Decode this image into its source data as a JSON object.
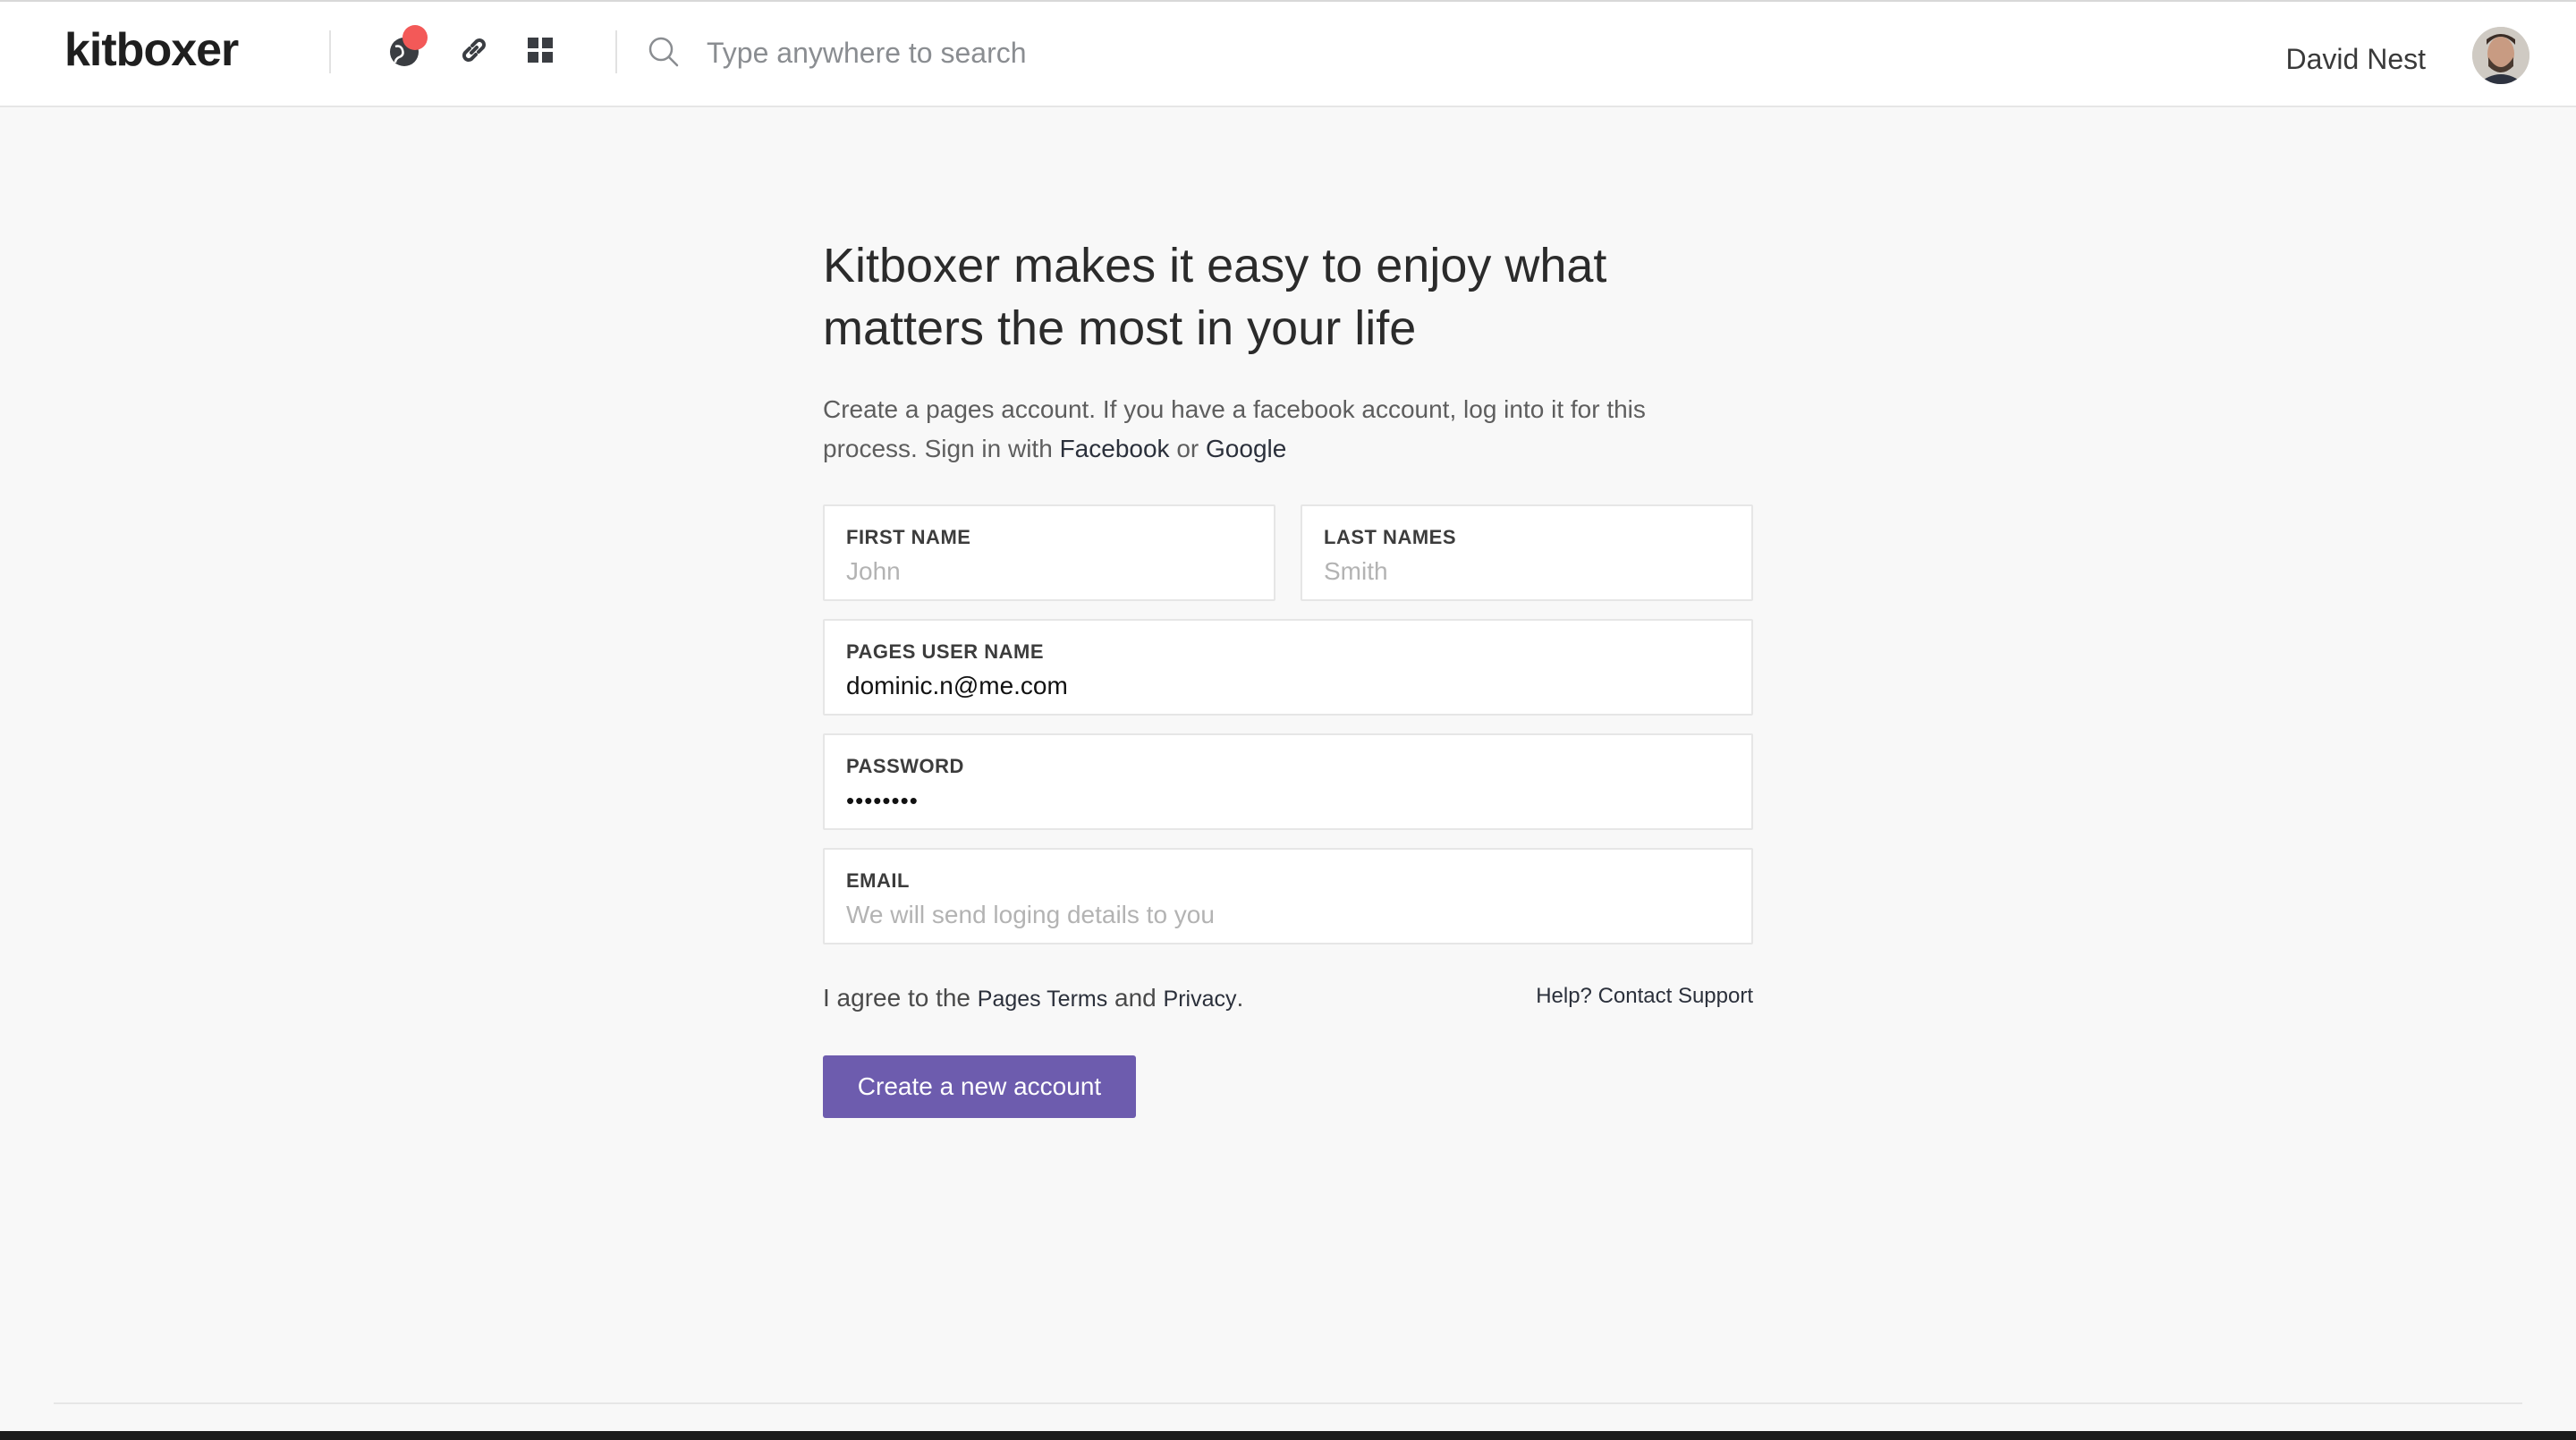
{
  "header": {
    "brand": "kitboxer",
    "icons": [
      "globe-icon",
      "link-icon",
      "grid-icon"
    ],
    "search": {
      "placeholder": "Type anywhere to search"
    },
    "user_name": "David Nest",
    "notification_color": "#f35958"
  },
  "main": {
    "headline": "Kitboxer makes it easy to enjoy what matters the most in your life",
    "intro_text": "Create a pages account. If you have a facebook account, log into it for this process. Sign in with",
    "facebook_link": "Facebook",
    "or": "or",
    "google_link": "Google",
    "fields": {
      "first_name": {
        "label": "FIRST NAME",
        "placeholder": "John",
        "value": ""
      },
      "last_name": {
        "label": "LAST NAMES",
        "placeholder": "Smith",
        "value": ""
      },
      "username": {
        "label": "PAGES USER NAME",
        "value": "dominic.n@me.com"
      },
      "password": {
        "label": "PASSWORD",
        "value": "••••••••"
      },
      "email": {
        "label": "EMAIL",
        "placeholder": "We will send loging details to you",
        "value": ""
      }
    },
    "agree": {
      "prefix": "I agree to the",
      "terms": "Pages Terms",
      "and": "and",
      "privacy": "Privacy",
      "suffix": "."
    },
    "help": "Help? Contact Support",
    "submit_label": "Create a new account",
    "accent_color": "#6d5cae"
  }
}
